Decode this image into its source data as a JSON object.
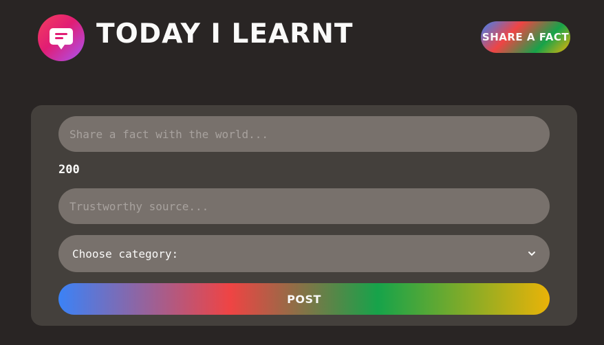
{
  "header": {
    "title": "Today I Learnt",
    "logo_icon": "speech-bubble-icon",
    "share_button_label": "Share a fact"
  },
  "form": {
    "fact_placeholder": "Share a fact with the world...",
    "fact_value": "",
    "char_count": "200",
    "source_placeholder": "Trustworthy source...",
    "source_value": "",
    "category_selected": "Choose category:",
    "post_button_label": "Post"
  },
  "colors": {
    "background": "#292524",
    "card": "#44403c",
    "field": "#78716c",
    "text": "#fafaf9",
    "gradient": [
      "#3b82f6",
      "#ef4444",
      "#16a34a",
      "#eab308"
    ]
  }
}
